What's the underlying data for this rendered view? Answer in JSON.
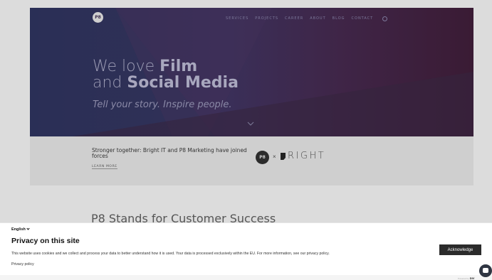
{
  "header": {
    "logo_text": "P8",
    "nav": [
      {
        "label": "SERVICES"
      },
      {
        "label": "PROJECTS"
      },
      {
        "label": "CAREER"
      },
      {
        "label": "ABOUT"
      },
      {
        "label": "BLOG"
      },
      {
        "label": "CONTACT"
      }
    ]
  },
  "hero": {
    "line1_pre": "We love ",
    "line1_bold": "Film",
    "line2_pre": "and ",
    "line2_bold": "Social Media",
    "tagline": "Tell your story. Inspire people."
  },
  "promo": {
    "text": "Stronger together: Bright IT and P8 Marketing have joined forces",
    "link": "LEARN MORE",
    "badge": "P8",
    "times": "×",
    "brand": "RIGHT"
  },
  "section": {
    "title": "P8 Stands for Customer Success"
  },
  "cookie": {
    "language": "English",
    "title": "Privacy on this site",
    "description": "This website uses cookies and we collect and process your data to better understand how it is used. Your data is processed exclusively within the EU. For more information, see our privacy policy.",
    "policy_link": "Privacy policy",
    "acknowledge_label": "Acknowledge"
  },
  "footer": {
    "powered_by": "Powered by",
    "powered_brand": "DIV"
  },
  "colors": {
    "hero_left": "#2c2e55",
    "hero_right": "#3a1b34",
    "button": "#2b2b2b"
  }
}
